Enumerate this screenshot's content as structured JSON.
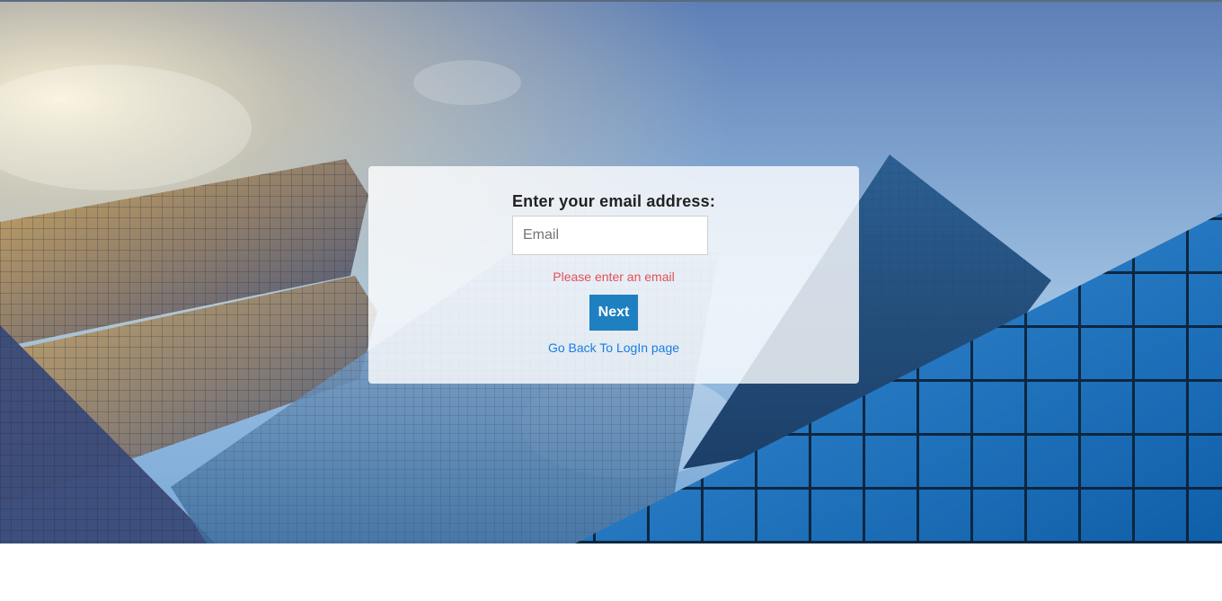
{
  "form": {
    "title": "Enter your email address:",
    "email_placeholder": "Email",
    "email_value": "",
    "error_message": "Please enter an email",
    "next_label": "Next",
    "back_link_label": "Go Back To LogIn page"
  },
  "colors": {
    "button": "#1e7fc1",
    "error": "#e0505a",
    "link": "#1a7ee0"
  }
}
